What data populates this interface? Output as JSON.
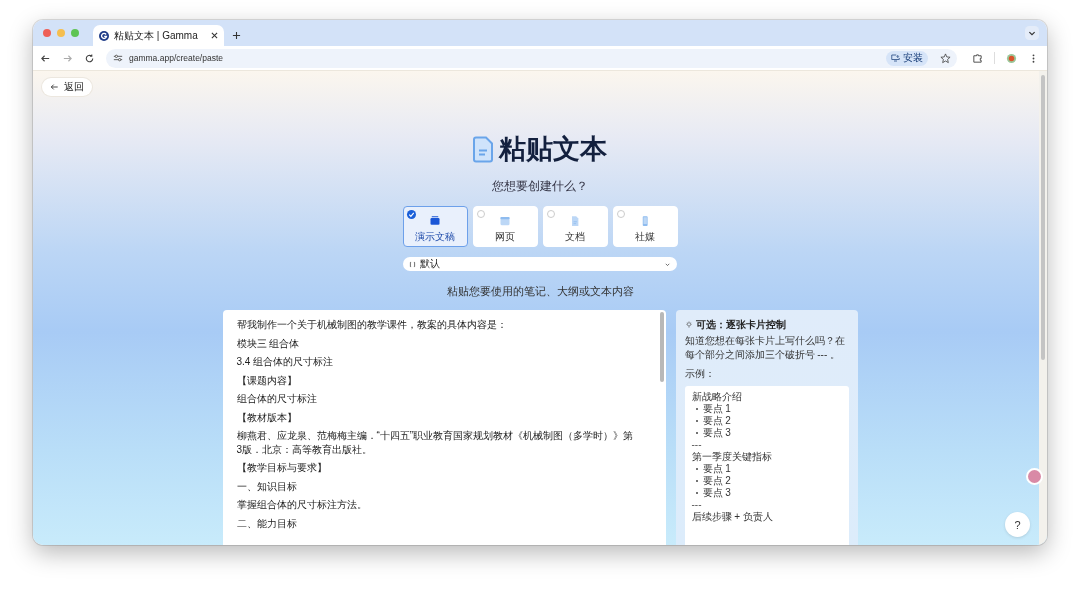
{
  "browser": {
    "tab_title": "粘贴文本 | Gamma",
    "url": "gamma.app/create/paste",
    "install_label": "安装"
  },
  "back_label": "返回",
  "title": "粘贴文本",
  "subtitle": "您想要创建什么？",
  "types": [
    {
      "kind": "presentation",
      "label": "演示文稿",
      "selected": true
    },
    {
      "kind": "webpage",
      "label": "网页",
      "selected": false
    },
    {
      "kind": "document",
      "label": "文档",
      "selected": false
    },
    {
      "kind": "social",
      "label": "社媒",
      "selected": false
    }
  ],
  "theme_dropdown": {
    "value": "默认"
  },
  "prompt_label": "粘贴您要使用的笔记、大纲或文本内容",
  "editor_lines": [
    "帮我制作一个关于机械制图的教学课件，教案的具体内容是：",
    "模块三 组合体",
    "3.4 组合体的尺寸标注",
    "【课题内容】",
    "组合体的尺寸标注",
    "【教材版本】",
    "柳燕君、应龙泉、范梅梅主编．“十四五”职业教育国家规划教材《机械制图（多学时）》第3版．北京：高等教育出版社。",
    "【教学目标与要求】",
    "一、知识目标",
    "掌握组合体的尺寸标注方法。",
    "二、能力目标"
  ],
  "tip": {
    "title": "可选：逐张卡片控制",
    "body": "知道您想在每张卡片上写什么吗？在每个部分之间添加三个破折号 --- 。",
    "example_label": "示例：",
    "sections": [
      {
        "heading": "新战略介绍",
        "points": [
          "要点 1",
          "要点 2",
          "要点 3"
        ],
        "separator": "---"
      },
      {
        "heading": "第一季度关键指标",
        "points": [
          "要点 1",
          "要点 2",
          "要点 3"
        ],
        "separator": "---"
      },
      {
        "heading": "后续步骤 + 负责人"
      }
    ]
  },
  "help_label": "?"
}
